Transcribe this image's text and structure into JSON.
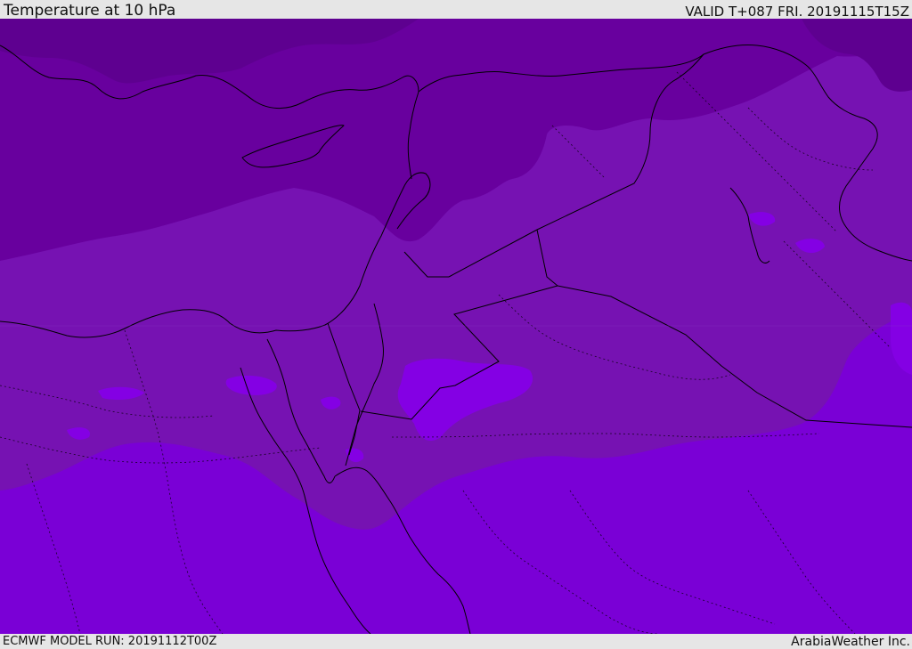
{
  "header": {
    "title": "Temperature at 10 hPa",
    "valid": "VALID T+087 FRI. 20191115T15Z"
  },
  "footer": {
    "model_run": "ECMWF MODEL RUN: 20191112T00Z",
    "credit": "ArabiaWeather Inc."
  },
  "colors": {
    "band_coldest": "#5e0090",
    "band_cold": "#68009e",
    "band_mid": "#7612b2",
    "band_warm": "#7a00d6",
    "patch": "#8400e4",
    "coastline": "#000000",
    "border": "#000000"
  }
}
